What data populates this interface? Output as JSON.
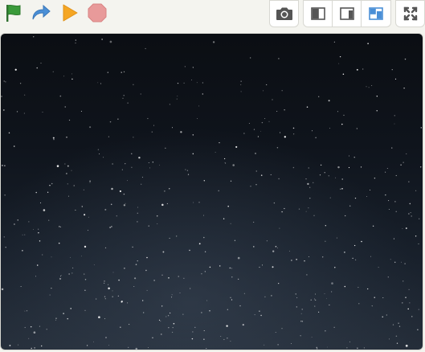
{
  "toolbar": {
    "controls": [
      {
        "name": "green-flag",
        "icon": "flag-icon",
        "color": "#3a8a3a"
      },
      {
        "name": "redo",
        "icon": "redo-arrow-icon",
        "color": "#4a8fd6"
      },
      {
        "name": "play",
        "icon": "play-icon",
        "color": "#f5a623"
      },
      {
        "name": "stop",
        "icon": "stop-icon",
        "color": "#e88a8a"
      }
    ],
    "view_buttons": [
      {
        "name": "screenshot",
        "icon": "camera-icon"
      },
      {
        "name": "layout-left",
        "icon": "layout-left-panel-icon"
      },
      {
        "name": "layout-right",
        "icon": "layout-right-panel-icon"
      },
      {
        "name": "layout-small-stage",
        "icon": "layout-small-stage-icon",
        "accent": "#4a8fd6"
      },
      {
        "name": "fullscreen",
        "icon": "fullscreen-icon"
      }
    ]
  },
  "stage": {
    "background": "starry-night-sky",
    "colors": {
      "top": "#0b0e13",
      "bottom": "#252e3a",
      "star": "#ffffff"
    }
  }
}
